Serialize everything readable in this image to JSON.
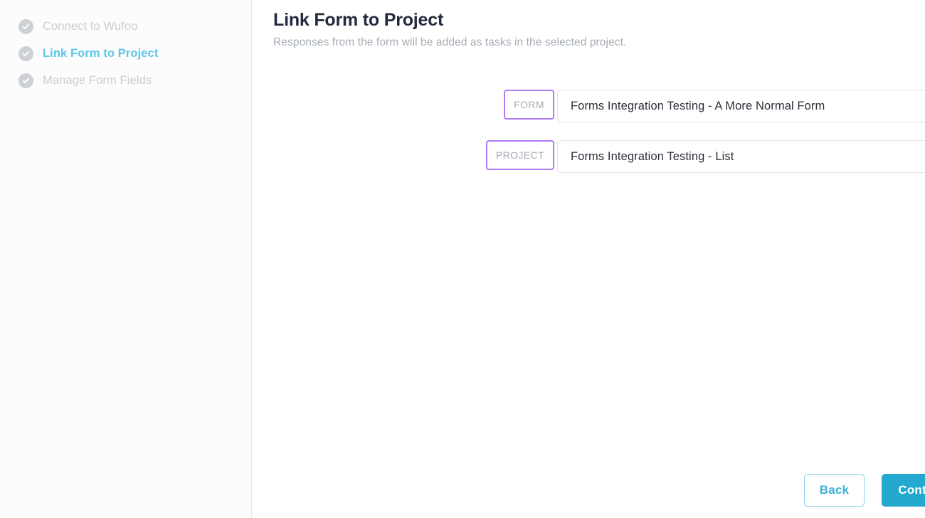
{
  "sidebar": {
    "steps": [
      {
        "label": "Connect to Wufoo",
        "state": "done",
        "icon": "check-circle-icon"
      },
      {
        "label": "Link Form to Project",
        "state": "active",
        "icon": "check-circle-icon"
      },
      {
        "label": "Manage Form Fields",
        "state": "done",
        "icon": "check-circle-icon"
      }
    ]
  },
  "main": {
    "title": "Link Form to Project",
    "subtitle": "Responses from the form will be added as tasks in the selected project.",
    "fields": [
      {
        "label": "FORM",
        "value": "Forms Integration Testing - A More Normal Form",
        "control": "select",
        "icon": "select-arrows-icon"
      },
      {
        "label": "PROJECT",
        "value": "Forms Integration Testing - List",
        "control": "text",
        "icon": "clear-circle-icon"
      }
    ]
  },
  "footer": {
    "back_label": "Back",
    "continue_label": "Continue"
  },
  "colors": {
    "accent": "#22a9cd",
    "active_step": "#5cc6e8",
    "label_border": "#b07cf5",
    "muted_text": "#c9ced4",
    "title": "#232a3d"
  }
}
